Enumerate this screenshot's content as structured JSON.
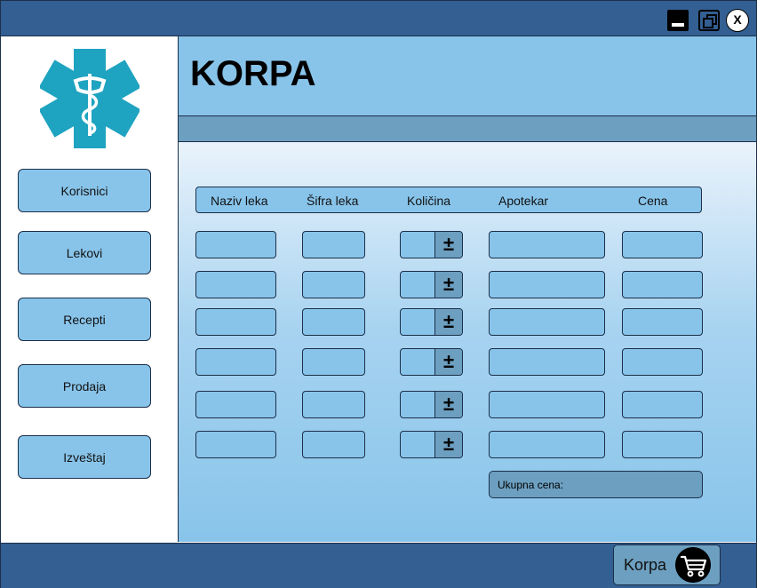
{
  "window": {
    "minimize_icon": "minimize-icon",
    "restore_icon": "restore-icon",
    "close_label": "X"
  },
  "sidebar": {
    "logo": "star-of-life-icon",
    "items": [
      {
        "label": "Korisnici"
      },
      {
        "label": "Lekovi"
      },
      {
        "label": "Recepti"
      },
      {
        "label": "Prodaja"
      },
      {
        "label": "Izveštaj"
      }
    ]
  },
  "header": {
    "title": "KORPA"
  },
  "table": {
    "columns": [
      "Naziv leka",
      "Šifra leka",
      "Količina",
      "Apotekar",
      "Cena"
    ],
    "row_count": 6,
    "stepper_label": "±"
  },
  "total": {
    "label": "Ukupna cena:"
  },
  "footer": {
    "cart_label": "Korpa",
    "cart_icon": "shopping-cart-icon"
  },
  "colors": {
    "titlebar": "#335f92",
    "accent": "#88c4ea",
    "secondary": "#6c9fc0",
    "logo": "#1ea3c0"
  }
}
